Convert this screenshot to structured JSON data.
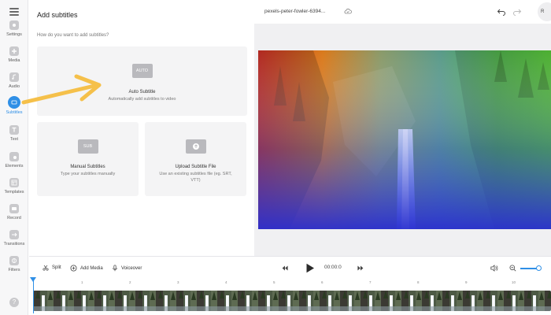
{
  "sidebar": {
    "items": [
      {
        "label": "Settings",
        "icon": "gear-icon"
      },
      {
        "label": "Media",
        "icon": "plus-icon"
      },
      {
        "label": "Audio",
        "icon": "music-note-icon"
      },
      {
        "label": "Subtitles",
        "icon": "subtitles-icon",
        "active": true
      },
      {
        "label": "Text",
        "icon": "text-icon"
      },
      {
        "label": "Elements",
        "icon": "shapes-icon"
      },
      {
        "label": "Templates",
        "icon": "templates-icon"
      },
      {
        "label": "Record",
        "icon": "record-icon"
      },
      {
        "label": "Transitions",
        "icon": "transitions-icon"
      },
      {
        "label": "Filters",
        "icon": "filters-icon"
      }
    ],
    "help": "?"
  },
  "panel": {
    "title": "Add subtitles",
    "subtitle": "How do you want to add subtitles?",
    "cards": {
      "auto": {
        "badge": "AUTO",
        "title": "Auto Subtitle",
        "desc": "Automatically add subtitles to video"
      },
      "manual": {
        "badge": "SUB",
        "title": "Manual Subtitles",
        "desc": "Type your subtitles manually"
      },
      "upload": {
        "title": "Upload Subtitle File",
        "desc": "Use an existing subtitles file (eg. SRT, VTT)"
      }
    }
  },
  "topbar": {
    "filename": "pexels-peter-fowler-6394...",
    "avatar": "R"
  },
  "timeline": {
    "split": "Split",
    "add_media": "Add Media",
    "voiceover": "Voiceover",
    "time": "00:00:0",
    "ticks": [
      "1",
      "2",
      "3",
      "4",
      "5",
      "6",
      "7",
      "8",
      "9",
      "10"
    ]
  },
  "colors": {
    "accent": "#2f8fe6",
    "annotation_arrow": "#f5c04a"
  }
}
